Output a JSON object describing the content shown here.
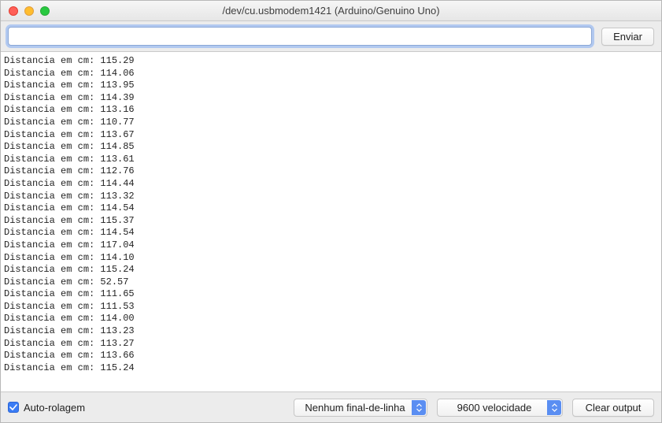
{
  "window": {
    "title": "/dev/cu.usbmodem1421 (Arduino/Genuino Uno)"
  },
  "toolbar": {
    "input_value": "",
    "input_placeholder": "",
    "send_label": "Enviar"
  },
  "serial_output": {
    "line_prefix": "Distancia em cm: ",
    "values": [
      "115.29",
      "114.06",
      "113.95",
      "114.39",
      "113.16",
      "110.77",
      "113.67",
      "114.85",
      "113.61",
      "112.76",
      "114.44",
      "113.32",
      "114.54",
      "115.37",
      "114.54",
      "117.04",
      "114.10",
      "115.24",
      "52.57",
      "111.65",
      "111.53",
      "114.00",
      "113.23",
      "113.27",
      "113.66",
      "115.24"
    ]
  },
  "bottombar": {
    "autoscroll_label": "Auto-rolagem",
    "autoscroll_checked": true,
    "line_ending_selected": "Nenhum final-de-linha",
    "baud_selected": "9600 velocidade",
    "clear_label": "Clear output"
  }
}
